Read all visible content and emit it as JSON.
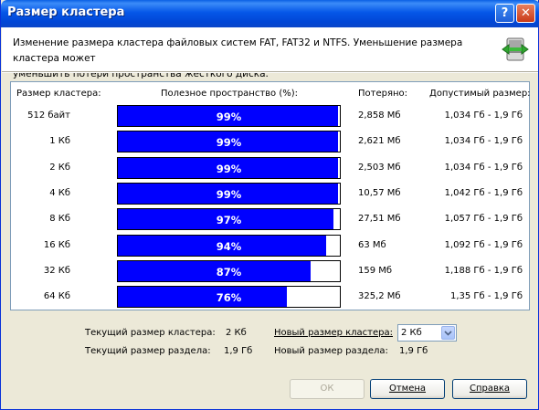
{
  "window": {
    "title": "Размер кластера"
  },
  "header": {
    "line1": "Изменение размера кластера файловых систем FAT, FAT32 и NTFS. Уменьшение размера кластера может",
    "line2": "уменьшить потери пространства жесткого диска."
  },
  "table": {
    "headers": {
      "size": "Размер кластера:",
      "usable": "Полезное пространство (%):",
      "lost": "Потеряно:",
      "range": "Допустимый размер:"
    },
    "rows": [
      {
        "size": "512 байт",
        "percent": 99,
        "percent_label": "99%",
        "lost": "2,858 Мб",
        "range": "1,034 Гб - 1,9 Гб"
      },
      {
        "size": "1 Кб",
        "percent": 99,
        "percent_label": "99%",
        "lost": "2,621 Мб",
        "range": "1,034 Гб - 1,9 Гб"
      },
      {
        "size": "2 Кб",
        "percent": 99,
        "percent_label": "99%",
        "lost": "2,503 Мб",
        "range": "1,034 Гб - 1,9 Гб"
      },
      {
        "size": "4 Кб",
        "percent": 99,
        "percent_label": "99%",
        "lost": "10,57 Мб",
        "range": "1,042 Гб - 1,9 Гб"
      },
      {
        "size": "8 Кб",
        "percent": 97,
        "percent_label": "97%",
        "lost": "27,51 Мб",
        "range": "1,057 Гб - 1,9 Гб"
      },
      {
        "size": "16 Кб",
        "percent": 94,
        "percent_label": "94%",
        "lost": "63 Мб",
        "range": "1,092 Гб - 1,9 Гб"
      },
      {
        "size": "32 Кб",
        "percent": 87,
        "percent_label": "87%",
        "lost": "159 Мб",
        "range": "1,188 Гб - 1,9 Гб"
      },
      {
        "size": "64 Кб",
        "percent": 76,
        "percent_label": "76%",
        "lost": "325,2 Мб",
        "range": "1,35 Гб - 1,9 Гб"
      }
    ]
  },
  "info": {
    "current_cluster_label": "Текущий размер кластера:",
    "current_cluster_value": "2 Кб",
    "current_partition_label": "Текущий размер раздела:",
    "current_partition_value": "1,9 Гб",
    "new_cluster_label": "Новый размер кластера:",
    "new_cluster_value": "2 Кб",
    "new_partition_label": "Новый размер раздела:",
    "new_partition_value": "1,9 Гб"
  },
  "buttons": {
    "ok": "ОК",
    "cancel": "Отмена",
    "help": "Справка"
  },
  "colors": {
    "bar_fill": "#0000ff",
    "titlebar": "#0054e3"
  }
}
